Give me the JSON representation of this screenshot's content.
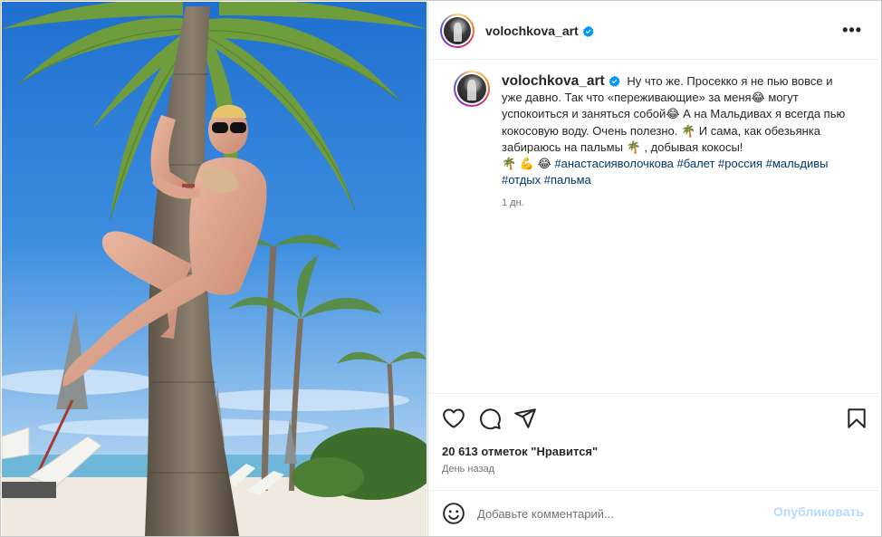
{
  "post": {
    "username": "volochkova_art",
    "verified_icon": "verified-badge-icon",
    "more_icon": "more-options-icon",
    "caption": {
      "text_1": "Ну что же. Просекко я не пью вовсе и уже давно. Так что «переживающие» за меня",
      "emoji_1": "😂",
      "text_2": " могут успокоиться и заняться собой",
      "emoji_2": "😂",
      "text_3": " А на Мальдивах я всегда пью кокосовую воду. Очень полезно. ",
      "emoji_3": "🌴",
      "text_4": " И сама, как обезьянка забираюсь на пальмы ",
      "emoji_4": "🌴",
      "text_5": " , добывая кокосы! ",
      "emoji_5": "🌴 💪 😂",
      "hashtags": [
        "#анастасияволочкова",
        "#балет",
        "#россия",
        "#мальдивы",
        "#отдых",
        "#пальма"
      ]
    },
    "caption_time": "1 дн.",
    "likes": "20 613 отметок \"Нравится\"",
    "posted_ago": "День назад",
    "comment_placeholder": "Добавьте комментарий...",
    "publish_label": "Опубликовать",
    "colors": {
      "link": "#00376b",
      "verified": "#0095f6",
      "publish_disabled": "#b3dbff",
      "secondary_text": "#737373"
    }
  }
}
